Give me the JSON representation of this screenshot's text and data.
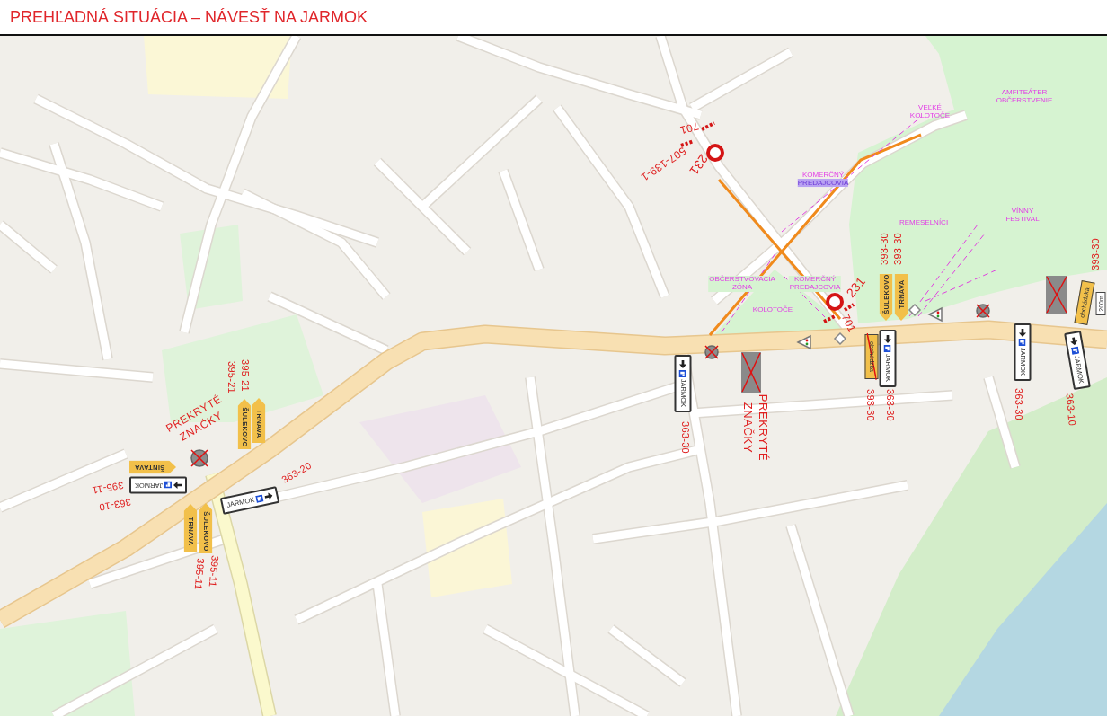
{
  "title": "PREHĽADNÁ SITUÁCIA – NÁVESŤ NA JARMOK",
  "map": {
    "zone_labels": [
      {
        "lines": [
          "VEĽKÉ",
          "KOLOTOČE"
        ],
        "highlighted": false
      },
      {
        "lines": [
          "AMFITEÁTER",
          "OBČERSTVENIE"
        ],
        "highlighted": false
      },
      {
        "lines": [
          "KOMERČNÝ",
          "PREDAJCOVIA"
        ],
        "highlighted": true
      },
      {
        "lines": [
          "REMESELNÍCI"
        ],
        "highlighted": false
      },
      {
        "lines": [
          "VÍNNY",
          "FESTIVAL"
        ],
        "highlighted": false
      },
      {
        "lines": [
          "OBČERSTVOVACIA",
          "ZÓNA"
        ],
        "highlighted": false
      },
      {
        "lines": [
          "KOMERČNÝ",
          "PREDAJCOVIA"
        ],
        "highlighted": false
      },
      {
        "lines": [
          "KOLOTOČE"
        ],
        "highlighted": false
      }
    ],
    "sign_codes": [
      "701",
      "507-139-1",
      "231",
      "231",
      "701",
      "393-30",
      "393-30",
      "393-30",
      "393-30",
      "363-30",
      "363-30",
      "363-10",
      "363-30",
      "395-21",
      "395-21",
      "395-11",
      "363-10",
      "363-20",
      "395-11",
      "395-11"
    ],
    "notes": [
      {
        "lines": [
          "PREKRYTÉ",
          "ZNAČKY"
        ]
      },
      {
        "lines": [
          "PREKRYTÉ",
          "ZNAČKY"
        ]
      }
    ],
    "boards": [
      {
        "kind": "direction",
        "text": "ŠULEKOVO",
        "crossed": false
      },
      {
        "kind": "direction",
        "text": "TRNAVA",
        "crossed": false
      },
      {
        "kind": "direction",
        "text": "ŠINTAVA",
        "crossed": false
      },
      {
        "kind": "parking",
        "text": "JARMOK",
        "crossed": false
      },
      {
        "kind": "parking",
        "text": "JARMOK",
        "crossed": false
      },
      {
        "kind": "direction",
        "text": "TRNAVA",
        "crossed": false
      },
      {
        "kind": "direction",
        "text": "ŠULEKOVO",
        "crossed": false
      },
      {
        "kind": "direction",
        "text": "ŠULEKOVO",
        "crossed": false
      },
      {
        "kind": "direction",
        "text": "TRNAVA",
        "crossed": false
      },
      {
        "kind": "detour",
        "text": "obchádzka",
        "crossed": true
      },
      {
        "kind": "parking",
        "text": "JARMOK",
        "crossed": false
      },
      {
        "kind": "parking",
        "text": "JARMOK",
        "crossed": false
      },
      {
        "kind": "detour",
        "text": "obchádzka",
        "crossed": false
      },
      {
        "kind": "distance",
        "text": "200m",
        "crossed": false
      },
      {
        "kind": "parking",
        "text": "JARMOK",
        "crossed": false
      },
      {
        "kind": "parking",
        "text": "JARMOK",
        "crossed": false
      }
    ]
  }
}
